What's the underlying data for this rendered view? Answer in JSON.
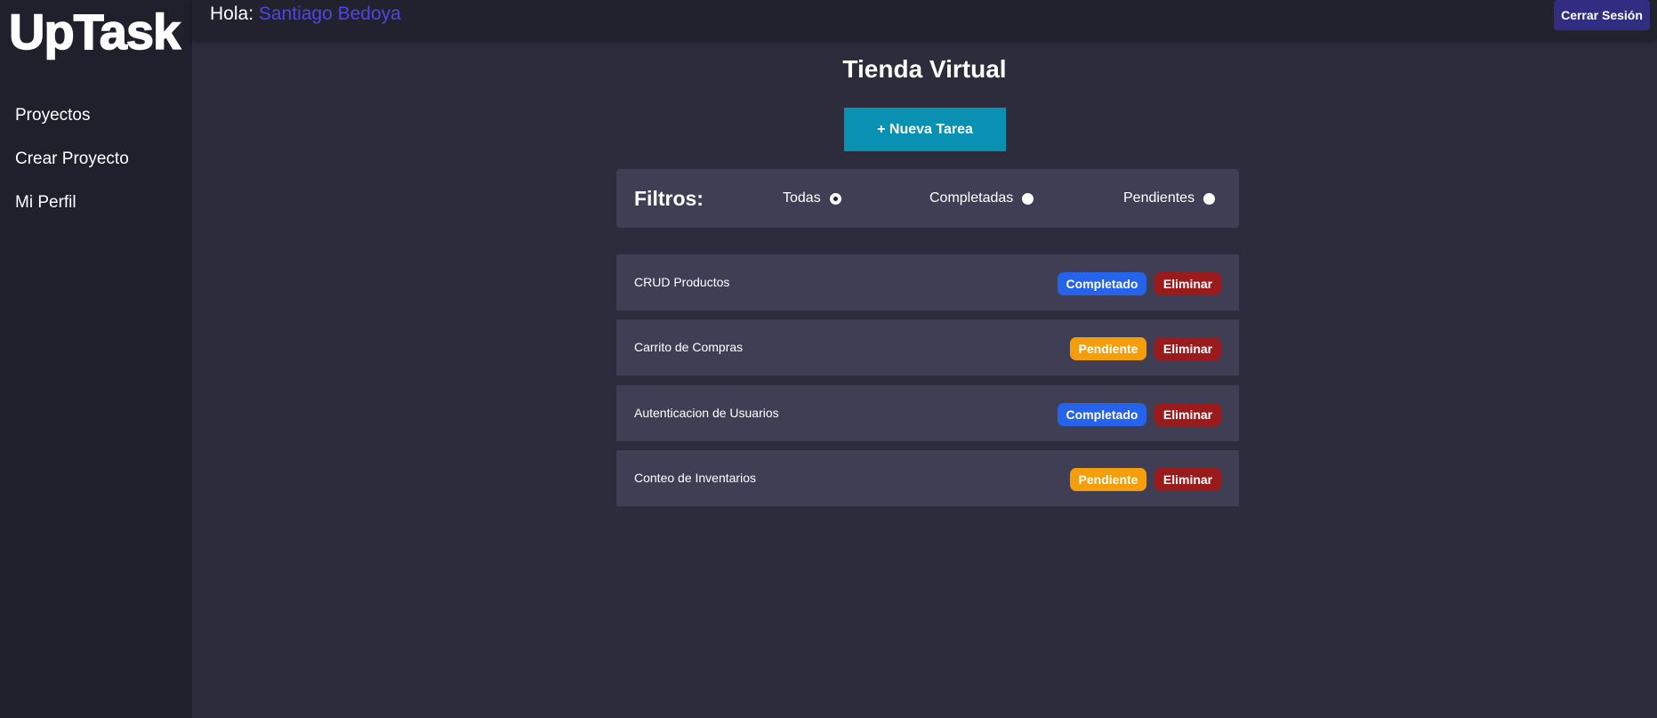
{
  "app": {
    "logo": "UpTask"
  },
  "sidebar": {
    "items": [
      {
        "label": "Proyectos"
      },
      {
        "label": "Crear Proyecto"
      },
      {
        "label": "Mi Perfil"
      }
    ]
  },
  "header": {
    "greeting": "Hola:",
    "user_name": "Santiago Bedoya",
    "logout_label": "Cerrar Sesión"
  },
  "project": {
    "title": "Tienda Virtual",
    "new_task_label": "+ Nueva Tarea"
  },
  "filters": {
    "title": "Filtros:",
    "options": [
      {
        "label": "Todas",
        "checked": true
      },
      {
        "label": "Completadas",
        "checked": false
      },
      {
        "label": "Pendientes",
        "checked": false
      }
    ]
  },
  "tasks": [
    {
      "name": "CRUD Productos",
      "status": "Completado",
      "delete_label": "Eliminar"
    },
    {
      "name": "Carrito de Compras",
      "status": "Pendiente",
      "delete_label": "Eliminar"
    },
    {
      "name": "Autenticacion de Usuarios",
      "status": "Completado",
      "delete_label": "Eliminar"
    },
    {
      "name": "Conteo de Inventarios",
      "status": "Pendiente",
      "delete_label": "Eliminar"
    }
  ],
  "colors": {
    "completed": "#2563eb",
    "pending": "#f59e0b",
    "delete": "#991b1b",
    "accent": "#0891b2",
    "user_name": "#4f46e5"
  }
}
